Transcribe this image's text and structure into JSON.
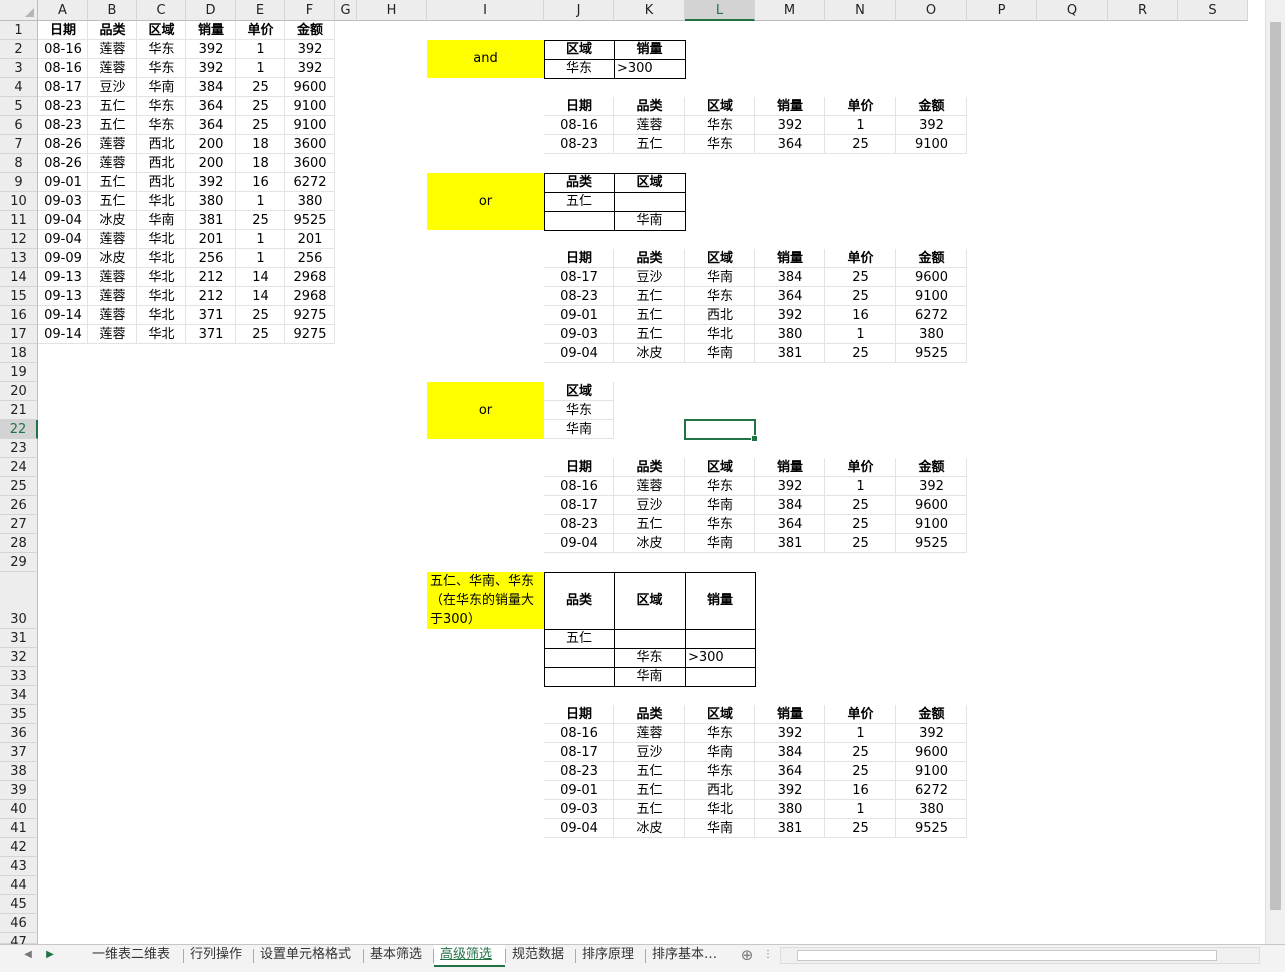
{
  "columns": [
    "A",
    "B",
    "C",
    "D",
    "E",
    "F",
    "G",
    "H",
    "I",
    "J",
    "K",
    "L",
    "M",
    "N",
    "O",
    "P",
    "Q",
    "R",
    "S"
  ],
  "selected_column": "L",
  "selected_row": 22,
  "cells": [
    [
      "A1",
      "日期",
      1
    ],
    [
      "B1",
      "品类",
      1
    ],
    [
      "C1",
      "区域",
      1
    ],
    [
      "D1",
      "销量",
      1
    ],
    [
      "E1",
      "单价",
      1
    ],
    [
      "F1",
      "金额",
      1
    ],
    [
      "A2",
      "08-16"
    ],
    [
      "B2",
      "莲蓉"
    ],
    [
      "C2",
      "华东"
    ],
    [
      "D2",
      "392"
    ],
    [
      "E2",
      "1"
    ],
    [
      "F2",
      "392"
    ],
    [
      "A3",
      "08-16"
    ],
    [
      "B3",
      "莲蓉"
    ],
    [
      "C3",
      "华东"
    ],
    [
      "D3",
      "392"
    ],
    [
      "E3",
      "1"
    ],
    [
      "F3",
      "392"
    ],
    [
      "A4",
      "08-17"
    ],
    [
      "B4",
      "豆沙"
    ],
    [
      "C4",
      "华南"
    ],
    [
      "D4",
      "384"
    ],
    [
      "E4",
      "25"
    ],
    [
      "F4",
      "9600"
    ],
    [
      "A5",
      "08-23"
    ],
    [
      "B5",
      "五仁"
    ],
    [
      "C5",
      "华东"
    ],
    [
      "D5",
      "364"
    ],
    [
      "E5",
      "25"
    ],
    [
      "F5",
      "9100"
    ],
    [
      "A6",
      "08-23"
    ],
    [
      "B6",
      "五仁"
    ],
    [
      "C6",
      "华东"
    ],
    [
      "D6",
      "364"
    ],
    [
      "E6",
      "25"
    ],
    [
      "F6",
      "9100"
    ],
    [
      "A7",
      "08-26"
    ],
    [
      "B7",
      "莲蓉"
    ],
    [
      "C7",
      "西北"
    ],
    [
      "D7",
      "200"
    ],
    [
      "E7",
      "18"
    ],
    [
      "F7",
      "3600"
    ],
    [
      "A8",
      "08-26"
    ],
    [
      "B8",
      "莲蓉"
    ],
    [
      "C8",
      "西北"
    ],
    [
      "D8",
      "200"
    ],
    [
      "E8",
      "18"
    ],
    [
      "F8",
      "3600"
    ],
    [
      "A9",
      "09-01"
    ],
    [
      "B9",
      "五仁"
    ],
    [
      "C9",
      "西北"
    ],
    [
      "D9",
      "392"
    ],
    [
      "E9",
      "16"
    ],
    [
      "F9",
      "6272"
    ],
    [
      "A10",
      "09-03"
    ],
    [
      "B10",
      "五仁"
    ],
    [
      "C10",
      "华北"
    ],
    [
      "D10",
      "380"
    ],
    [
      "E10",
      "1"
    ],
    [
      "F10",
      "380"
    ],
    [
      "A11",
      "09-04"
    ],
    [
      "B11",
      "冰皮"
    ],
    [
      "C11",
      "华南"
    ],
    [
      "D11",
      "381"
    ],
    [
      "E11",
      "25"
    ],
    [
      "F11",
      "9525"
    ],
    [
      "A12",
      "09-04"
    ],
    [
      "B12",
      "莲蓉"
    ],
    [
      "C12",
      "华北"
    ],
    [
      "D12",
      "201"
    ],
    [
      "E12",
      "1"
    ],
    [
      "F12",
      "201"
    ],
    [
      "A13",
      "09-09"
    ],
    [
      "B13",
      "冰皮"
    ],
    [
      "C13",
      "华北"
    ],
    [
      "D13",
      "256"
    ],
    [
      "E13",
      "1"
    ],
    [
      "F13",
      "256"
    ],
    [
      "A14",
      "09-13"
    ],
    [
      "B14",
      "莲蓉"
    ],
    [
      "C14",
      "华北"
    ],
    [
      "D14",
      "212"
    ],
    [
      "E14",
      "14"
    ],
    [
      "F14",
      "2968"
    ],
    [
      "A15",
      "09-13"
    ],
    [
      "B15",
      "莲蓉"
    ],
    [
      "C15",
      "华北"
    ],
    [
      "D15",
      "212"
    ],
    [
      "E15",
      "14"
    ],
    [
      "F15",
      "2968"
    ],
    [
      "A16",
      "09-14"
    ],
    [
      "B16",
      "莲蓉"
    ],
    [
      "C16",
      "华北"
    ],
    [
      "D16",
      "371"
    ],
    [
      "E16",
      "25"
    ],
    [
      "F16",
      "9275"
    ],
    [
      "A17",
      "09-14"
    ],
    [
      "B17",
      "莲蓉"
    ],
    [
      "C17",
      "华北"
    ],
    [
      "D17",
      "371"
    ],
    [
      "E17",
      "25"
    ],
    [
      "F17",
      "9275"
    ],
    [
      "I2",
      "and"
    ],
    [
      "J2",
      "区域",
      1
    ],
    [
      "K2",
      "销量",
      1
    ],
    [
      "J3",
      "华东"
    ],
    [
      "K3",
      ">300"
    ],
    [
      "J5",
      "日期",
      1
    ],
    [
      "K5",
      "品类",
      1
    ],
    [
      "L5",
      "区域",
      1
    ],
    [
      "M5",
      "销量",
      1
    ],
    [
      "N5",
      "单价",
      1
    ],
    [
      "O5",
      "金额",
      1
    ],
    [
      "J6",
      "08-16"
    ],
    [
      "K6",
      "莲蓉"
    ],
    [
      "L6",
      "华东"
    ],
    [
      "M6",
      "392"
    ],
    [
      "N6",
      "1"
    ],
    [
      "O6",
      "392"
    ],
    [
      "J7",
      "08-23"
    ],
    [
      "K7",
      "五仁"
    ],
    [
      "L7",
      "华东"
    ],
    [
      "M7",
      "364"
    ],
    [
      "N7",
      "25"
    ],
    [
      "O7",
      "9100"
    ],
    [
      "I9",
      "or"
    ],
    [
      "J9",
      "品类",
      1
    ],
    [
      "K9",
      "区域",
      1
    ],
    [
      "J10",
      "五仁"
    ],
    [
      "K11",
      "华南"
    ],
    [
      "J13",
      "日期",
      1
    ],
    [
      "K13",
      "品类",
      1
    ],
    [
      "L13",
      "区域",
      1
    ],
    [
      "M13",
      "销量",
      1
    ],
    [
      "N13",
      "单价",
      1
    ],
    [
      "O13",
      "金额",
      1
    ],
    [
      "J14",
      "08-17"
    ],
    [
      "K14",
      "豆沙"
    ],
    [
      "L14",
      "华南"
    ],
    [
      "M14",
      "384"
    ],
    [
      "N14",
      "25"
    ],
    [
      "O14",
      "9600"
    ],
    [
      "J15",
      "08-23"
    ],
    [
      "K15",
      "五仁"
    ],
    [
      "L15",
      "华东"
    ],
    [
      "M15",
      "364"
    ],
    [
      "N15",
      "25"
    ],
    [
      "O15",
      "9100"
    ],
    [
      "J16",
      "09-01"
    ],
    [
      "K16",
      "五仁"
    ],
    [
      "L16",
      "西北"
    ],
    [
      "M16",
      "392"
    ],
    [
      "N16",
      "16"
    ],
    [
      "O16",
      "6272"
    ],
    [
      "J17",
      "09-03"
    ],
    [
      "K17",
      "五仁"
    ],
    [
      "L17",
      "华北"
    ],
    [
      "M17",
      "380"
    ],
    [
      "N17",
      "1"
    ],
    [
      "O17",
      "380"
    ],
    [
      "J18",
      "09-04"
    ],
    [
      "K18",
      "冰皮"
    ],
    [
      "L18",
      "华南"
    ],
    [
      "M18",
      "381"
    ],
    [
      "N18",
      "25"
    ],
    [
      "O18",
      "9525"
    ],
    [
      "I20",
      "or"
    ],
    [
      "J20",
      "区域",
      1
    ],
    [
      "J21",
      "华东"
    ],
    [
      "J22",
      "华南"
    ],
    [
      "J24",
      "日期",
      1
    ],
    [
      "K24",
      "品类",
      1
    ],
    [
      "L24",
      "区域",
      1
    ],
    [
      "M24",
      "销量",
      1
    ],
    [
      "N24",
      "单价",
      1
    ],
    [
      "O24",
      "金额",
      1
    ],
    [
      "J25",
      "08-16"
    ],
    [
      "K25",
      "莲蓉"
    ],
    [
      "L25",
      "华东"
    ],
    [
      "M25",
      "392"
    ],
    [
      "N25",
      "1"
    ],
    [
      "O25",
      "392"
    ],
    [
      "J26",
      "08-17"
    ],
    [
      "K26",
      "豆沙"
    ],
    [
      "L26",
      "华南"
    ],
    [
      "M26",
      "384"
    ],
    [
      "N26",
      "25"
    ],
    [
      "O26",
      "9600"
    ],
    [
      "J27",
      "08-23"
    ],
    [
      "K27",
      "五仁"
    ],
    [
      "L27",
      "华东"
    ],
    [
      "M27",
      "364"
    ],
    [
      "N27",
      "25"
    ],
    [
      "O27",
      "9100"
    ],
    [
      "J28",
      "09-04"
    ],
    [
      "K28",
      "冰皮"
    ],
    [
      "L28",
      "华南"
    ],
    [
      "M28",
      "381"
    ],
    [
      "N28",
      "25"
    ],
    [
      "O28",
      "9525"
    ],
    [
      "I30",
      "五仁、华南、华东（在华东的销量大于300）"
    ],
    [
      "J30",
      "品类",
      1
    ],
    [
      "K30",
      "区域",
      1
    ],
    [
      "L30",
      "销量",
      1
    ],
    [
      "J31",
      "五仁"
    ],
    [
      "K32",
      "华东"
    ],
    [
      "L32",
      ">300"
    ],
    [
      "K33",
      "华南"
    ],
    [
      "J35",
      "日期",
      1
    ],
    [
      "K35",
      "品类",
      1
    ],
    [
      "L35",
      "区域",
      1
    ],
    [
      "M35",
      "销量",
      1
    ],
    [
      "N35",
      "单价",
      1
    ],
    [
      "O35",
      "金额",
      1
    ],
    [
      "J36",
      "08-16"
    ],
    [
      "K36",
      "莲蓉"
    ],
    [
      "L36",
      "华东"
    ],
    [
      "M36",
      "392"
    ],
    [
      "N36",
      "1"
    ],
    [
      "O36",
      "392"
    ],
    [
      "J37",
      "08-17"
    ],
    [
      "K37",
      "豆沙"
    ],
    [
      "L37",
      "华南"
    ],
    [
      "M37",
      "384"
    ],
    [
      "N37",
      "25"
    ],
    [
      "O37",
      "9600"
    ],
    [
      "J38",
      "08-23"
    ],
    [
      "K38",
      "五仁"
    ],
    [
      "L38",
      "华东"
    ],
    [
      "M38",
      "364"
    ],
    [
      "N38",
      "25"
    ],
    [
      "O38",
      "9100"
    ],
    [
      "J39",
      "09-01"
    ],
    [
      "K39",
      "五仁"
    ],
    [
      "L39",
      "西北"
    ],
    [
      "M39",
      "392"
    ],
    [
      "N39",
      "16"
    ],
    [
      "O39",
      "6272"
    ],
    [
      "J40",
      "09-03"
    ],
    [
      "K40",
      "五仁"
    ],
    [
      "L40",
      "华北"
    ],
    [
      "M40",
      "380"
    ],
    [
      "N40",
      "1"
    ],
    [
      "O40",
      "380"
    ],
    [
      "J41",
      "09-04"
    ],
    [
      "K41",
      "冰皮"
    ],
    [
      "L41",
      "华南"
    ],
    [
      "M41",
      "381"
    ],
    [
      "N41",
      "25"
    ],
    [
      "O41",
      "9525"
    ]
  ],
  "sheet_tabs": [
    "一维表二维表",
    "行列操作",
    "设置单元格格式",
    "基本筛选",
    "高级筛选",
    "规范数据",
    "排序原理",
    "排序基本…"
  ],
  "active_tab": "高级筛选",
  "colors": {
    "accent": "#217346",
    "highlight": "#ffff00"
  }
}
